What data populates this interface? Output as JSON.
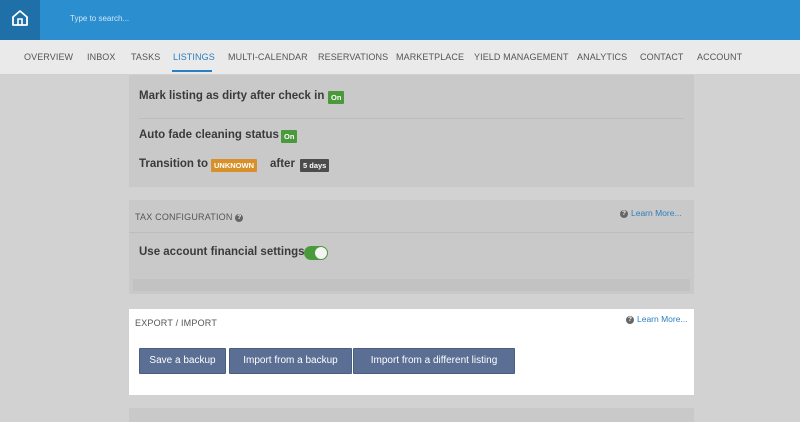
{
  "header": {
    "search_placeholder": "Type to search..."
  },
  "nav": {
    "items": [
      "OVERVIEW",
      "INBOX",
      "TASKS",
      "LISTINGS",
      "MULTI-CALENDAR",
      "RESERVATIONS",
      "MARKETPLACE",
      "YIELD MANAGEMENT",
      "ANALYTICS",
      "CONTACT",
      "ACCOUNT"
    ],
    "active": "LISTINGS"
  },
  "cleaning": {
    "dirty_label": "Mark listing as dirty after check in",
    "dirty_value": "On",
    "autofade_label": "Auto fade cleaning status",
    "autofade_value": "On",
    "transition_prefix": "Transition to",
    "transition_status": "UNKNOWN",
    "transition_middle": "after",
    "transition_days": "5 days"
  },
  "tax": {
    "title": "TAX CONFIGURATION",
    "learn_more": "Learn More...",
    "use_account_label": "Use account financial settings",
    "use_account_enabled": true
  },
  "export": {
    "title": "EXPORT / IMPORT",
    "learn_more": "Learn More...",
    "buttons": {
      "save_backup": "Save a backup",
      "import_backup": "Import from a backup",
      "import_listing": "Import from a different listing"
    }
  },
  "colors": {
    "header": "#2b8ecf",
    "accent": "#2b7fc0",
    "on_badge": "#4a9a3c",
    "unknown_badge": "#d8912a",
    "button": "#5a6f93"
  }
}
